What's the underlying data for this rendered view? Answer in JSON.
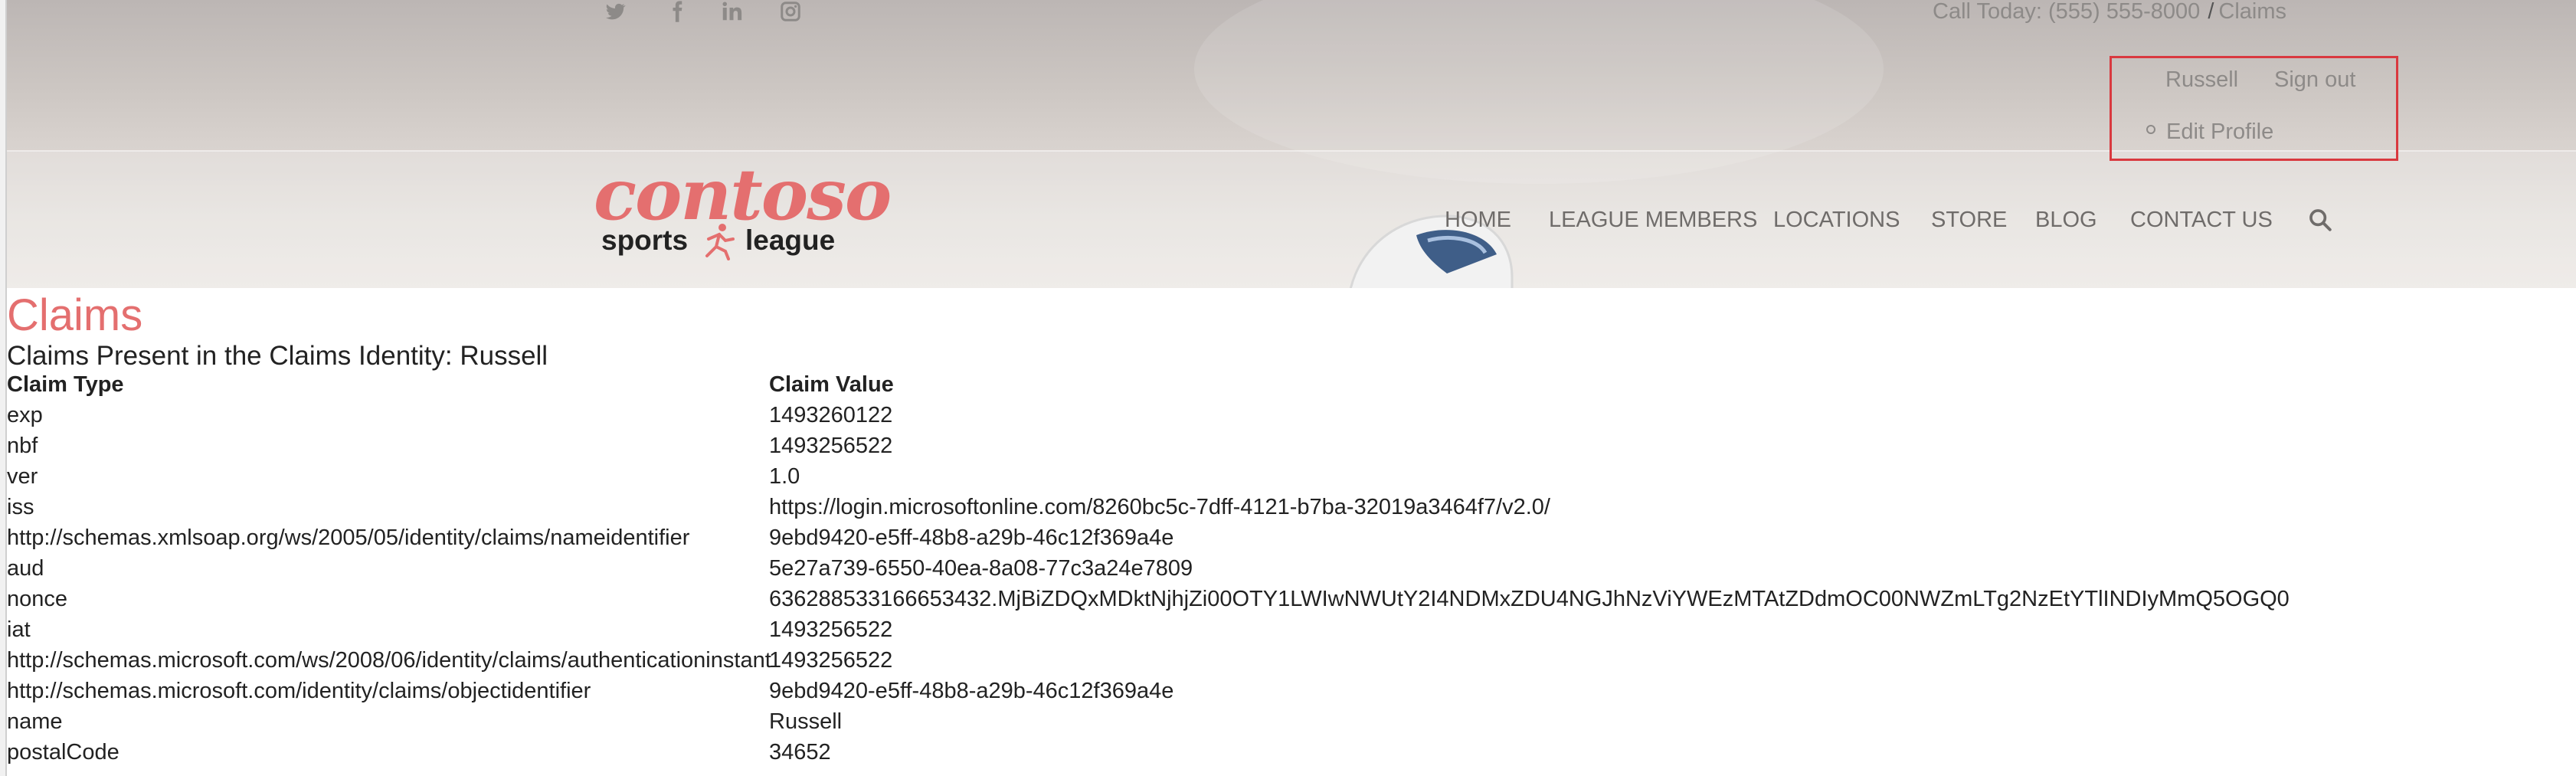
{
  "header": {
    "social_icons": [
      "twitter-icon",
      "facebook-icon",
      "linkedin-icon",
      "instagram-icon"
    ],
    "call_today": "Call Today: (555) 555-8000",
    "separator": "/",
    "breadcrumb_current": "Claims",
    "user_menu": {
      "username": "Russell",
      "sign_out": "Sign out",
      "edit_profile": "Edit Profile"
    },
    "logo": {
      "wordmark": "contoso",
      "left_word": "sports",
      "right_word": "league"
    },
    "nav": {
      "items": [
        "HOME",
        "LEAGUE MEMBERS",
        "LOCATIONS",
        "STORE",
        "BLOG",
        "CONTACT US"
      ],
      "search_icon": "search-icon"
    }
  },
  "main": {
    "title": "Claims",
    "subtitle": "Claims Present in the Claims Identity: Russell",
    "table": {
      "headers": [
        "Claim Type",
        "Claim Value"
      ],
      "rows": [
        [
          "exp",
          "1493260122"
        ],
        [
          "nbf",
          "1493256522"
        ],
        [
          "ver",
          "1.0"
        ],
        [
          "iss",
          "https://login.microsoftonline.com/8260bc5c-7dff-4121-b7ba-32019a3464f7/v2.0/"
        ],
        [
          "http://schemas.xmlsoap.org/ws/2005/05/identity/claims/nameidentifier",
          "9ebd9420-e5ff-48b8-a29b-46c12f369a4e"
        ],
        [
          "aud",
          "5e27a739-6550-40ea-8a08-77c3a24e7809"
        ],
        [
          "nonce",
          "636288533166653432.MjBiZDQxMDktNjhjZi00OTY1LWIwNWUtY2I4NDMxZDU4NGJhNzViYWEzMTAtZDdmOC00NWZmLTg2NzEtYTlINDIyMmQ5OGQ0"
        ],
        [
          "iat",
          "1493256522"
        ],
        [
          "http://schemas.microsoft.com/ws/2008/06/identity/claims/authenticationinstant",
          "1493256522"
        ],
        [
          "http://schemas.microsoft.com/identity/claims/objectidentifier",
          "9ebd9420-e5ff-48b8-a29b-46c12f369a4e"
        ],
        [
          "name",
          "Russell"
        ],
        [
          "postalCode",
          "34652"
        ]
      ]
    }
  },
  "colors": {
    "accent": "#e46f6f",
    "highlight_box": "#d9393f",
    "muted_text": "#8d8a88"
  }
}
